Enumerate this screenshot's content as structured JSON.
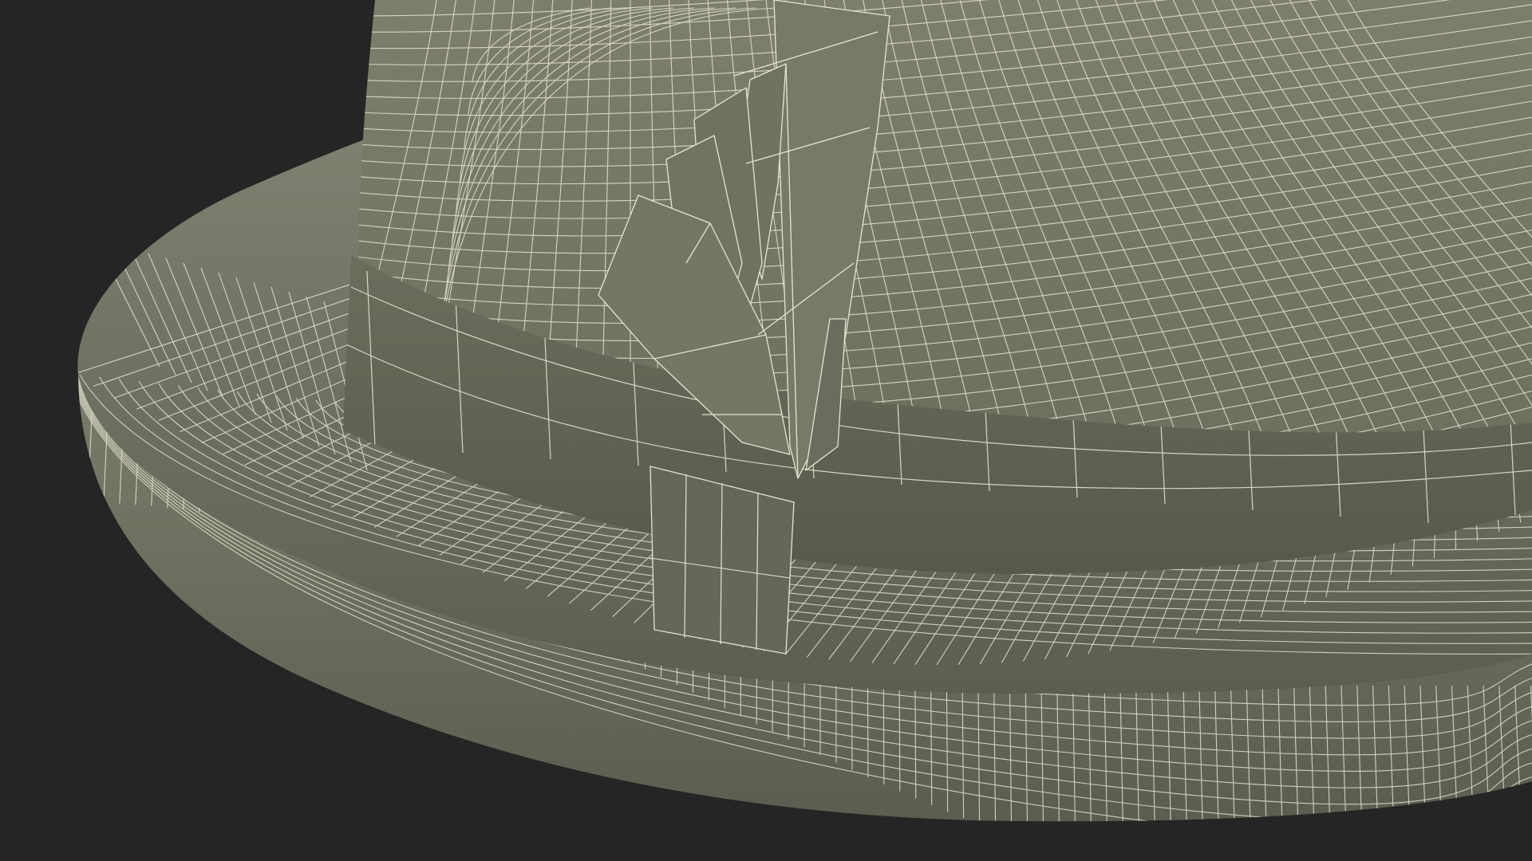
{
  "scene": {
    "background_color": "#252525",
    "subject_icon": "fedora-hat-wireframe-icon",
    "colors": {
      "brim_light": "#7e8070",
      "brim_dark": "#5c5e52",
      "crown_light": "#7d7f6c",
      "crown_dark": "#6a6c5c",
      "band": "#6b6d5d",
      "band_dark": "#575a4b",
      "feather": "#767867",
      "feather_dark": "#63655a",
      "wire": "#e6e4d2"
    }
  }
}
